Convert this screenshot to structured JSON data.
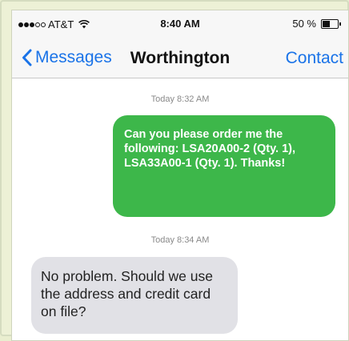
{
  "status_bar": {
    "carrier": "AT&T",
    "signal_bars_filled": 3,
    "signal_bars_total": 5,
    "time": "8:40 AM",
    "battery_text": "50 %",
    "battery_level": 0.5
  },
  "nav": {
    "back_label": "Messages",
    "title": "Worthington",
    "contact_label": "Contact"
  },
  "messages": [
    {
      "timestamp": "Today 8:32 AM",
      "direction": "outgoing",
      "text": "Can you please order me the following: LSA20A00-2 (Qty. 1), LSA33A00-1 (Qty. 1). Thanks!"
    },
    {
      "timestamp": "Today 8:34 AM",
      "direction": "incoming",
      "text": "No problem. Should we use the address and credit card on file?"
    }
  ],
  "colors": {
    "accent": "#1a73e8",
    "outgoing_bubble": "#3db74a",
    "incoming_bubble": "#e1e1e6",
    "page_background": "#e9eecf"
  }
}
